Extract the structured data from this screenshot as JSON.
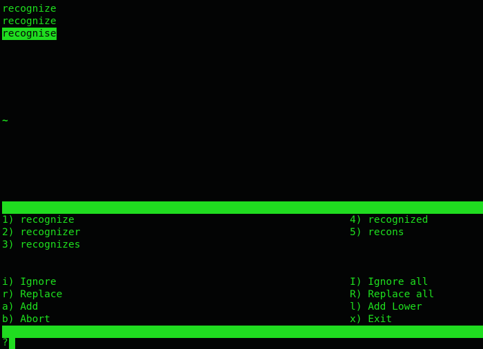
{
  "buffer": {
    "lines": [
      "recognize",
      "recognize"
    ],
    "highlighted": "recognise"
  },
  "tilde": "~",
  "suggestions": {
    "colA": [
      {
        "key": "1) ",
        "val": "recognize"
      },
      {
        "key": "2) ",
        "val": "recognizer"
      },
      {
        "key": "3) ",
        "val": "recognizes"
      }
    ],
    "colB": [
      {
        "key": "4) ",
        "val": "recognized"
      },
      {
        "key": "5) ",
        "val": "recons"
      }
    ]
  },
  "commands": {
    "colA": [
      {
        "key": "i) ",
        "val": "Ignore"
      },
      {
        "key": "r) ",
        "val": "Replace"
      },
      {
        "key": "a) ",
        "val": "Add"
      },
      {
        "key": "b) ",
        "val": "Abort"
      }
    ],
    "colB": [
      {
        "key": "I) ",
        "val": "Ignore all"
      },
      {
        "key": "R) ",
        "val": "Replace all"
      },
      {
        "key": "l) ",
        "val": "Add Lower"
      },
      {
        "key": "x) ",
        "val": "Exit"
      }
    ]
  },
  "prompt": "?"
}
